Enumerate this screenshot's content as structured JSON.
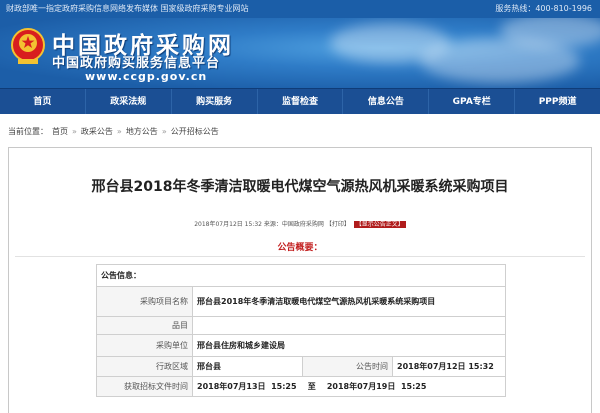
{
  "topbar": {
    "left": "财政部唯一指定政府采购信息网络发布媒体   国家级政府采购专业网站",
    "right": "服务热线：400-810-1996"
  },
  "banner": {
    "title": "中国政府采购网",
    "subtitle": "中国政府购买服务信息平台",
    "url": "www.ccgp.gov.cn"
  },
  "nav": [
    "首页",
    "政采法规",
    "购买服务",
    "监督检查",
    "信息公告",
    "GPA专栏",
    "PPP频道"
  ],
  "breadcrumb": {
    "prefix": "当前位置：",
    "items": [
      "首页",
      "政采公告",
      "地方公告",
      "公开招标公告"
    ],
    "separator": "»"
  },
  "article": {
    "title": "邢台县2018年冬季清洁取暖电代煤空气源热风机采暖系统采购项目",
    "date": "2018年07月12日  15:32",
    "source": "来源：中国政府采购网",
    "print": "【打印】",
    "show_original": "【显示公告正文】",
    "summary_title": "公告概要："
  },
  "table": {
    "header": "公告信息：",
    "rows": [
      {
        "label": "采购项目名称",
        "value": "邢台县2018年冬季清洁取暖电代煤空气源热风机采暖系统采购项目"
      },
      {
        "label": "品目",
        "value": ""
      },
      {
        "label": "采购单位",
        "value": "邢台县住房和城乡建设局"
      }
    ],
    "region_label": "行政区域",
    "region_value": "邢台县",
    "pubtime_label": "公告时间",
    "pubtime_value": "2018年07月12日  15:32",
    "file_label": "获取招标文件时间",
    "file_value": "2018年07月13日  15:25    至    2018年07月19日  15:25"
  }
}
